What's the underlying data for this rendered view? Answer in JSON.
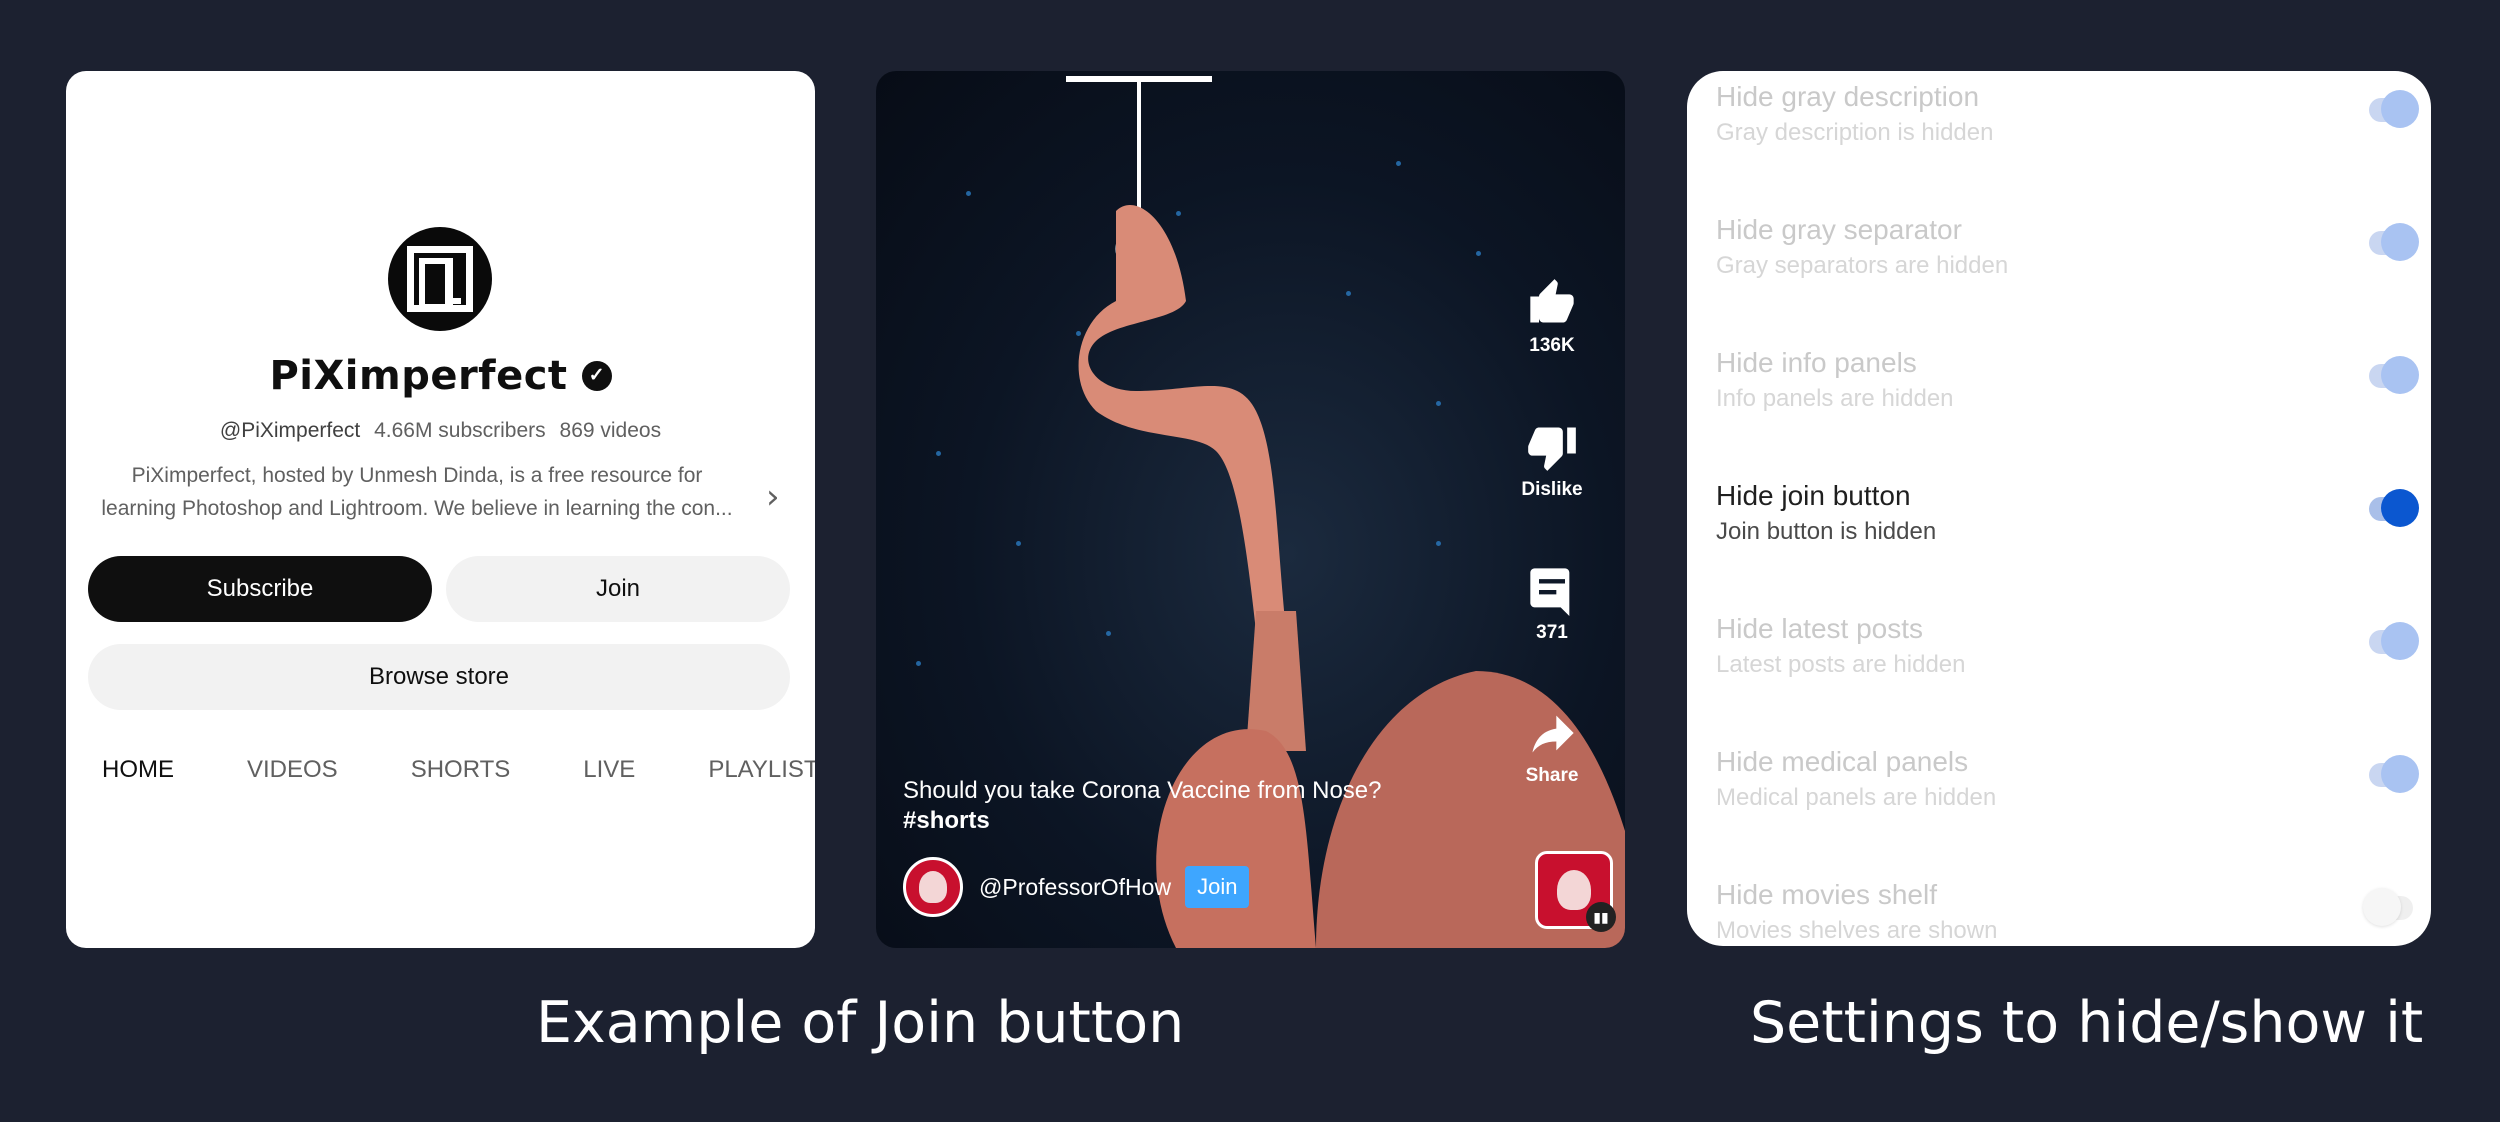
{
  "channel_page": {
    "title": "PiXimperfect",
    "verified_icon": "check-badge-icon",
    "handle": "@PiXimperfect",
    "subscribers": "4.66M subscribers",
    "videos": "869 videos",
    "description_line1": "PiXimperfect, hosted by Unmesh Dinda, is a free resource for",
    "description_line2": "learning Photoshop and Lightroom. We believe in learning the con...",
    "subscribe_label": "Subscribe",
    "join_label": "Join",
    "browse_store_label": "Browse store",
    "tabs": [
      {
        "label": "HOME",
        "active": true
      },
      {
        "label": "VIDEOS",
        "active": false
      },
      {
        "label": "SHORTS",
        "active": false
      },
      {
        "label": "LIVE",
        "active": false
      },
      {
        "label": "PLAYLISTS",
        "active": false
      }
    ]
  },
  "shorts": {
    "like_count": "136K",
    "dislike_label": "Dislike",
    "comment_count": "371",
    "share_label": "Share",
    "caption": "Should you take Corona Vaccine from Nose?",
    "hashtag": "#shorts",
    "channel_handle": "@ProfessorOfHow",
    "join_label": "Join"
  },
  "settings": [
    {
      "title": "Hide gray description",
      "subtitle": "Gray description is hidden",
      "state": "on",
      "dimmed": true
    },
    {
      "title": "Hide gray separator",
      "subtitle": "Gray separators are hidden",
      "state": "on",
      "dimmed": true
    },
    {
      "title": "Hide info panels",
      "subtitle": "Info panels are hidden",
      "state": "on",
      "dimmed": true
    },
    {
      "title": "Hide join button",
      "subtitle": "Join button is hidden",
      "state": "on",
      "dimmed": false
    },
    {
      "title": "Hide latest posts",
      "subtitle": "Latest posts are hidden",
      "state": "on",
      "dimmed": true
    },
    {
      "title": "Hide medical panels",
      "subtitle": "Medical panels are hidden",
      "state": "on",
      "dimmed": true
    },
    {
      "title": "Hide movies shelf",
      "subtitle": "Movies shelves are shown",
      "state": "off",
      "dimmed": true
    }
  ],
  "captions": {
    "left": "Example of Join button",
    "right": "Settings to hide/show it"
  },
  "colors": {
    "background": "#1c2130",
    "join_button_blue": "#3ea6ff",
    "toggle_accent": "#0b57d0"
  }
}
